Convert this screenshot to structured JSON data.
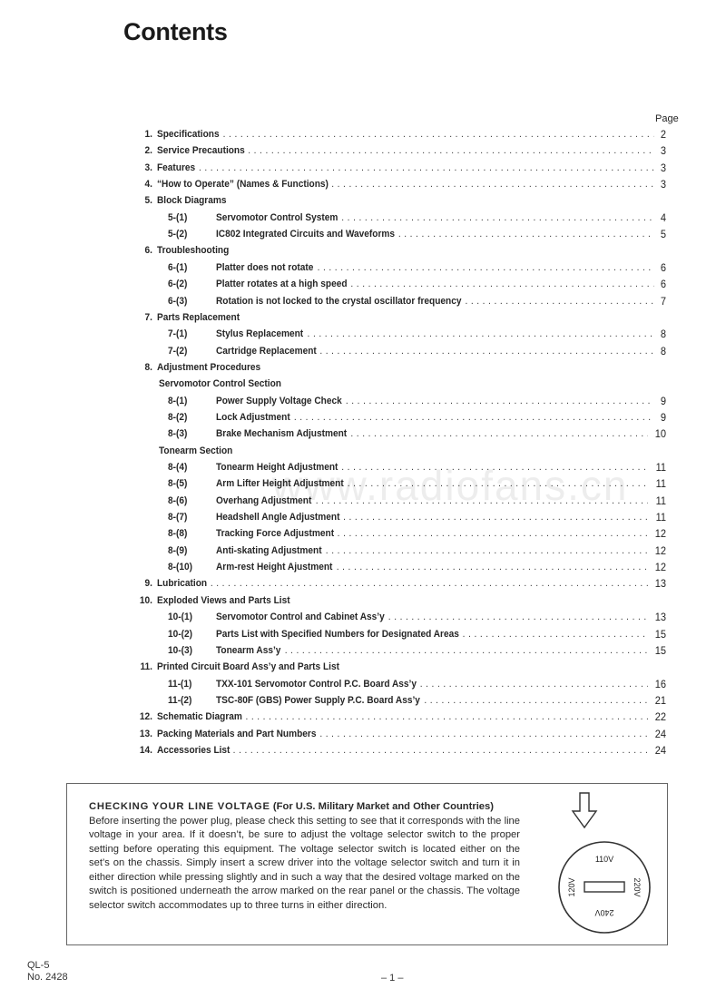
{
  "document": {
    "title": "Contents",
    "page_column_header": "Page",
    "watermark": "www.radiofans.cn"
  },
  "toc": [
    {
      "num": "1.",
      "label": "Specifications",
      "page": "2",
      "level": 0
    },
    {
      "num": "2.",
      "label": "Service Precautions",
      "page": "3",
      "level": 0
    },
    {
      "num": "3.",
      "label": "Features",
      "page": "3",
      "level": 0
    },
    {
      "num": "4.",
      "label": "“How to Operate” (Names & Functions)",
      "page": "3",
      "level": 0
    },
    {
      "num": "5.",
      "label": "Block Diagrams",
      "page": "",
      "level": 0
    },
    {
      "num": "5-(1)",
      "label": "Servomotor Control System",
      "page": "4",
      "level": 2
    },
    {
      "num": "5-(2)",
      "label": "IC802 Integrated Circuits and Waveforms",
      "page": "5",
      "level": 2
    },
    {
      "num": "6.",
      "label": "Troubleshooting",
      "page": "",
      "level": 0
    },
    {
      "num": "6-(1)",
      "label": "Platter does not rotate",
      "page": "6",
      "level": 2
    },
    {
      "num": "6-(2)",
      "label": "Platter rotates at a high speed",
      "page": "6",
      "level": 2
    },
    {
      "num": "6-(3)",
      "label": "Rotation is not locked to the crystal oscillator frequency",
      "page": "7",
      "level": 2
    },
    {
      "num": "7.",
      "label": "Parts Replacement",
      "page": "",
      "level": 0
    },
    {
      "num": "7-(1)",
      "label": "Stylus Replacement",
      "page": "8",
      "level": 2
    },
    {
      "num": "7-(2)",
      "label": "Cartridge Replacement",
      "page": "8",
      "level": 2
    },
    {
      "num": "8.",
      "label": "Adjustment Procedures",
      "page": "",
      "level": 0
    },
    {
      "num": "",
      "label": "Servomotor Control Section",
      "page": "",
      "level": 1
    },
    {
      "num": "8-(1)",
      "label": "Power Supply Voltage Check",
      "page": "9",
      "level": 2
    },
    {
      "num": "8-(2)",
      "label": "Lock Adjustment",
      "page": "9",
      "level": 2
    },
    {
      "num": "8-(3)",
      "label": "Brake Mechanism Adjustment",
      "page": "10",
      "level": 2
    },
    {
      "num": "",
      "label": "Tonearm Section",
      "page": "",
      "level": 1
    },
    {
      "num": "8-(4)",
      "label": "Tonearm Height Adjustment",
      "page": "11",
      "level": 2
    },
    {
      "num": "8-(5)",
      "label": "Arm Lifter Height Adjustment",
      "page": "11",
      "level": 2
    },
    {
      "num": "8-(6)",
      "label": "Overhang Adjustment",
      "page": "11",
      "level": 2
    },
    {
      "num": "8-(7)",
      "label": "Headshell Angle Adjustment",
      "page": "11",
      "level": 2
    },
    {
      "num": "8-(8)",
      "label": "Tracking Force Adjustment",
      "page": "12",
      "level": 2
    },
    {
      "num": "8-(9)",
      "label": "Anti-skating Adjustment",
      "page": "12",
      "level": 2
    },
    {
      "num": "8-(10)",
      "label": "Arm-rest Height Ajustment",
      "page": "12",
      "level": 2
    },
    {
      "num": "9.",
      "label": "Lubrication",
      "page": "13",
      "level": 0
    },
    {
      "num": "10.",
      "label": "Exploded Views and Parts List",
      "page": "",
      "level": 0
    },
    {
      "num": "10-(1)",
      "label": "Servomotor Control and Cabinet Ass’y",
      "page": "13",
      "level": 2
    },
    {
      "num": "10-(2)",
      "label": "Parts List with Specified Numbers for Designated Areas",
      "page": "15",
      "level": 2
    },
    {
      "num": "10-(3)",
      "label": "Tonearm Ass’y",
      "page": "15",
      "level": 2
    },
    {
      "num": "11.",
      "label": "Printed Circuit Board Ass’y and Parts List",
      "page": "",
      "level": 0
    },
    {
      "num": "11-(1)",
      "label": "TXX-101  Servomotor Control P.C. Board Ass’y",
      "page": "16",
      "level": 2
    },
    {
      "num": "11-(2)",
      "label": "TSC-80F (GBS) Power Supply P.C. Board Ass’y",
      "page": "21",
      "level": 2
    },
    {
      "num": "12.",
      "label": "Schematic Diagram",
      "page": "22",
      "level": 0
    },
    {
      "num": "13.",
      "label": "Packing Materials and Part Numbers",
      "page": "24",
      "level": 0
    },
    {
      "num": "14.",
      "label": "Accessories List",
      "page": "24",
      "level": 0
    }
  ],
  "notice": {
    "heading_caps": "CHECKING  YOUR  LINE  VOLTAGE",
    "heading_paren": "(For U.S. Military Market and Other Countries)",
    "body": "Before inserting the power plug, please check this setting to see that it corresponds with the line voltage in your area. If it doesn’t, be sure to adjust the voltage selector switch to the proper setting before operating this equipment. The voltage selector switch is located either on the set’s on the chassis. Simply insert a screw driver into the voltage selector switch and turn it in either direction while pressing slightly and in such a way that the desired voltage marked on the switch is positioned underneath the arrow marked on the rear panel or the chassis. The voltage selector switch accommodates up to three turns in either direction.",
    "selector": {
      "top": "110V",
      "right": "220V",
      "bottom": "240V",
      "left": "120V"
    }
  },
  "footer": {
    "model": "QL-5",
    "number": "No. 2428",
    "page": "– 1 –"
  }
}
